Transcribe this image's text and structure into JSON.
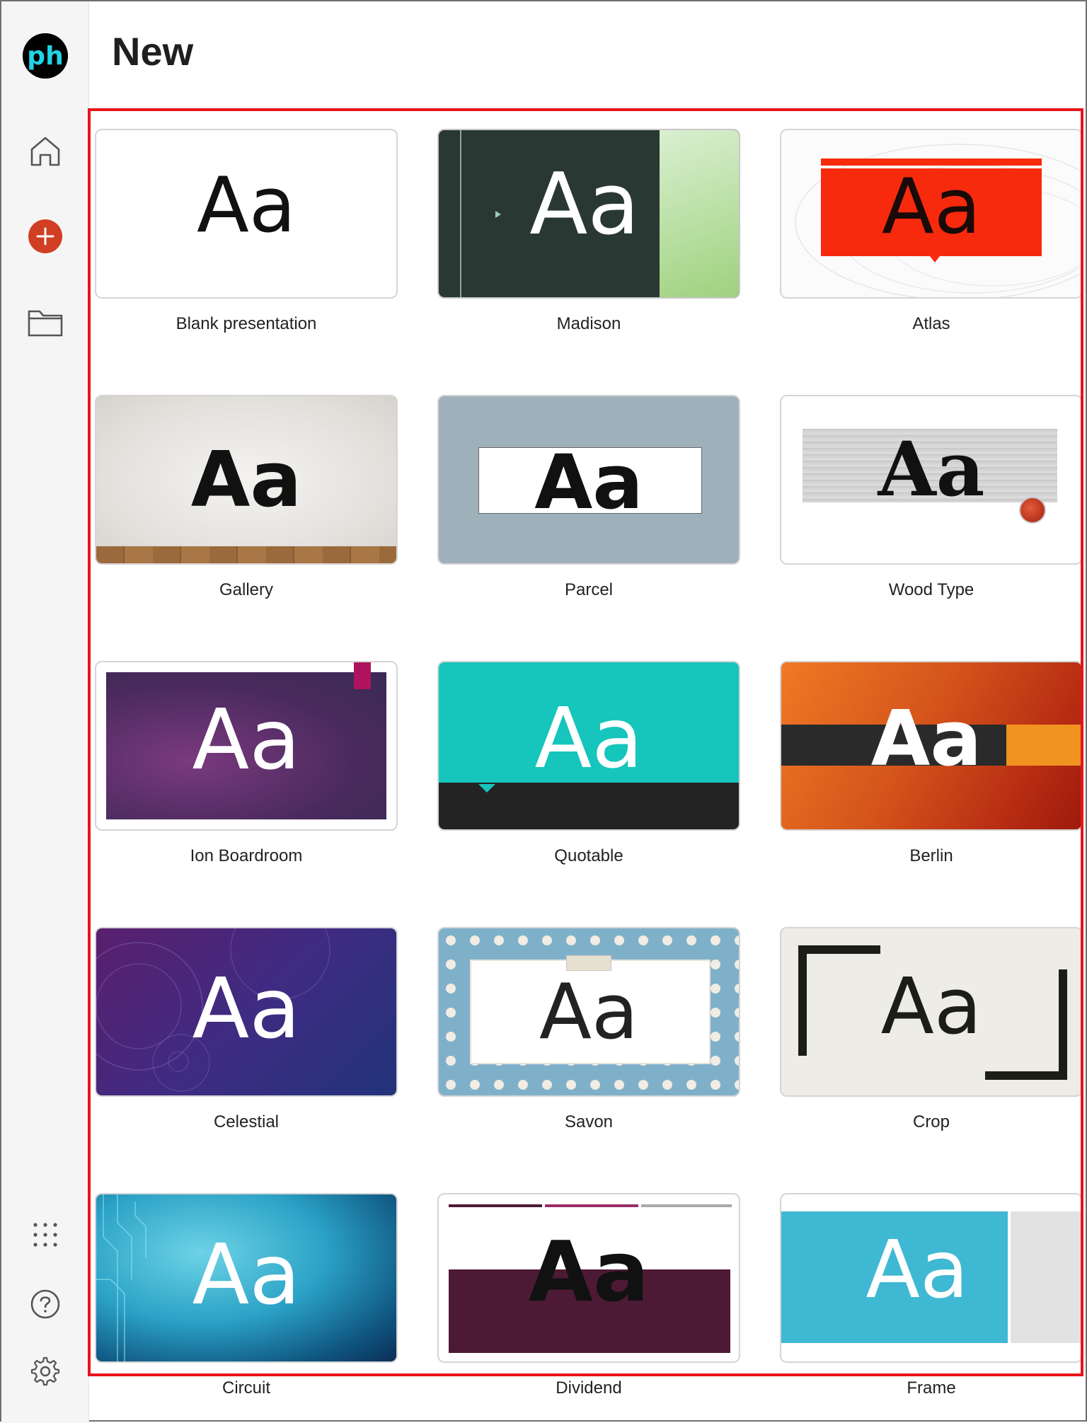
{
  "app": {
    "logo_text": "ph",
    "page_title": "New"
  },
  "sidebar": {
    "items": [
      {
        "name": "home",
        "icon": "home-icon"
      },
      {
        "name": "new",
        "icon": "plus-circle-icon"
      },
      {
        "name": "open",
        "icon": "folder-icon"
      },
      {
        "name": "apps",
        "icon": "grid-dots-icon"
      },
      {
        "name": "help",
        "icon": "help-icon"
      },
      {
        "name": "settings",
        "icon": "gear-icon"
      }
    ]
  },
  "templates": [
    {
      "name": "Blank presentation",
      "sample": "Aa"
    },
    {
      "name": "Madison",
      "sample": "Aa"
    },
    {
      "name": "Atlas",
      "sample": "Aa"
    },
    {
      "name": "Gallery",
      "sample": "Aa"
    },
    {
      "name": "Parcel",
      "sample": "Aa"
    },
    {
      "name": "Wood Type",
      "sample": "Aa"
    },
    {
      "name": "Ion Boardroom",
      "sample": "Aa"
    },
    {
      "name": "Quotable",
      "sample": "Aa"
    },
    {
      "name": "Berlin",
      "sample": "Aa"
    },
    {
      "name": "Celestial",
      "sample": "Aa"
    },
    {
      "name": "Savon",
      "sample": "Aa"
    },
    {
      "name": "Crop",
      "sample": "Aa"
    },
    {
      "name": "Circuit",
      "sample": "Aa"
    },
    {
      "name": "Dividend",
      "sample": "Aa"
    },
    {
      "name": "Frame",
      "sample": "Aa"
    }
  ],
  "colors": {
    "accent_red": "#d13f23",
    "highlight_border": "#e8141a",
    "logo_cyan": "#22d3e6"
  }
}
